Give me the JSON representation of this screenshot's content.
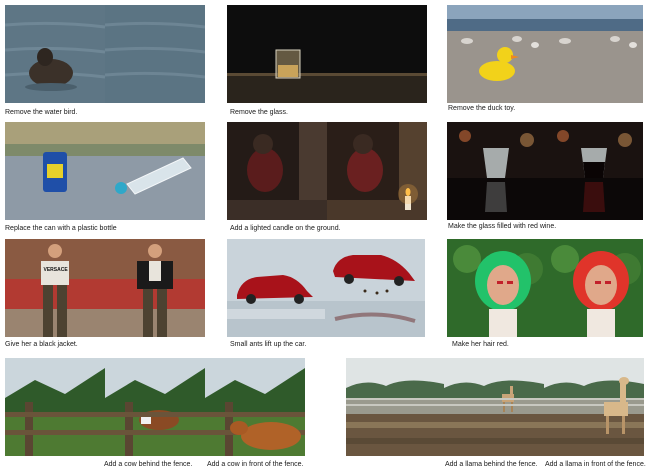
{
  "captions": {
    "remove_bird": "Remove the water bird.",
    "remove_glass": "Remove the glass.",
    "remove_duck": "Remove the duck toy.",
    "replace_can": "Replace the can with a plastic bottle",
    "add_candle": "Add a lighted candle on the ground.",
    "red_wine": "Make the glass filled with red wine.",
    "black_jacket": "Give her a black jacket.",
    "ants_lift": "Small ants lift up the car.",
    "hair_red": "Make her hair red.",
    "cow_behind": "Add a cow behind the fence.",
    "cow_front": "Add a cow in front of the fence.",
    "llama_behind": "Add a llama behind the fence.",
    "llama_front": "Add a llama in front of the fence."
  },
  "embedded_text": {
    "shirt_print": "VERSACE"
  }
}
